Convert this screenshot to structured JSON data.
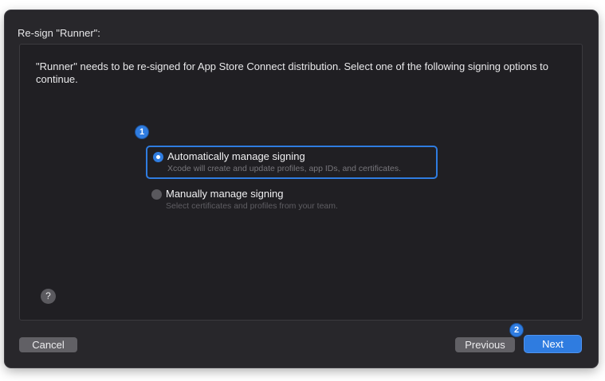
{
  "dialog": {
    "title": "Re-sign \"Runner\":",
    "description": "\"Runner\" needs to be re-signed for App Store Connect distribution. Select one of the following signing options to continue."
  },
  "options": [
    {
      "label": "Automatically manage signing",
      "sublabel": "Xcode will create and update profiles, app IDs, and certificates.",
      "selected": true
    },
    {
      "label": "Manually manage signing",
      "sublabel": "Select certificates and profiles from your team.",
      "selected": false
    }
  ],
  "badges": {
    "step1": "1",
    "step2": "2"
  },
  "help": {
    "label": "?"
  },
  "buttons": {
    "cancel": "Cancel",
    "previous": "Previous",
    "next": "Next"
  },
  "colors": {
    "accent": "#2f7ce0",
    "dialog_bg": "#28272b",
    "content_bg": "#201f23"
  }
}
